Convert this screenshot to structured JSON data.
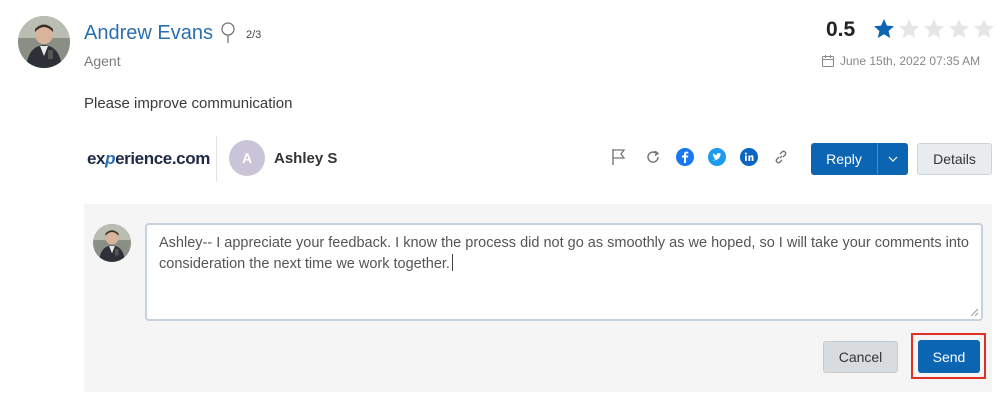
{
  "agent": {
    "name": "Andrew Evans",
    "step_count": "2/3",
    "role": "Agent"
  },
  "rating": {
    "score": "0.5",
    "stars_total": 5,
    "filled_fraction": 0.1
  },
  "date": "June 15th, 2022 07:35 AM",
  "review": {
    "text": "Please improve communication"
  },
  "source": {
    "brand_prefix": "ex",
    "brand_accent": "p",
    "brand_suffix": "erience.com"
  },
  "reviewer": {
    "initial": "A",
    "name": "Ashley S"
  },
  "actions": {
    "icons": [
      "flag-icon",
      "refresh-icon",
      "facebook-icon",
      "twitter-icon",
      "linkedin-icon",
      "link-icon"
    ],
    "reply_label": "Reply",
    "details_label": "Details"
  },
  "reply_form": {
    "message": "Ashley-- I appreciate your feedback. I know the process did not go as smoothly as we hoped, so I will take your comments into consideration the next time we work together.",
    "cancel_label": "Cancel",
    "send_label": "Send"
  },
  "colors": {
    "primary": "#0b65b3",
    "name_link": "#2a6fb0",
    "highlight": "#e03024",
    "star_filled": "#0b65b3",
    "star_empty": "#e6e6e6"
  }
}
